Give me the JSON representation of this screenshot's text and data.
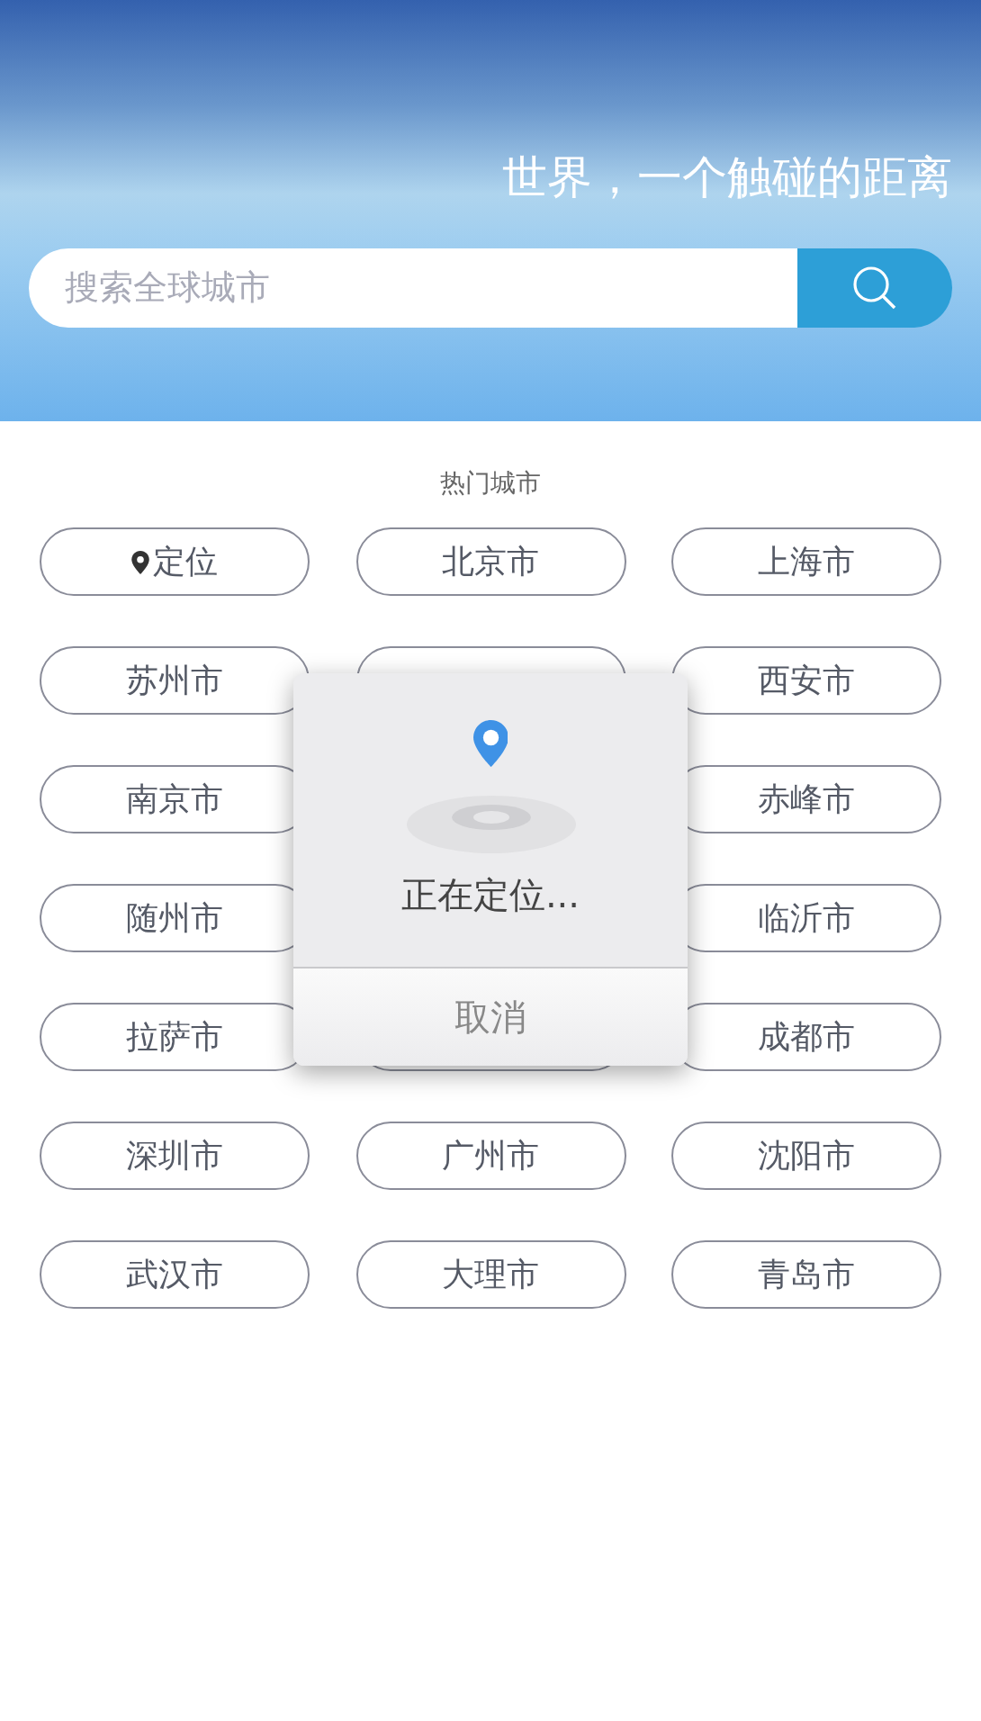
{
  "header": {
    "slogan": "世界，一个触碰的距离"
  },
  "search": {
    "placeholder": "搜索全球城市"
  },
  "hot_cities": {
    "title": "热门城市",
    "rows": [
      [
        {
          "kind": "locate",
          "label": "定位"
        },
        {
          "kind": "city",
          "label": "北京市"
        },
        {
          "kind": "city",
          "label": "上海市"
        }
      ],
      [
        {
          "kind": "city",
          "label": "苏州市"
        },
        {
          "kind": "covered"
        },
        {
          "kind": "city",
          "label": "西安市"
        }
      ],
      [
        {
          "kind": "city",
          "label": "南京市"
        },
        {
          "kind": "city",
          "label": "赤峰市"
        }
      ],
      [
        {
          "kind": "city",
          "label": "随州市"
        },
        {
          "kind": "city",
          "label": "临沂市"
        }
      ],
      [
        {
          "kind": "city",
          "label": "拉萨市"
        },
        {
          "kind": "covered"
        },
        {
          "kind": "city",
          "label": "成都市"
        }
      ],
      [
        {
          "kind": "city",
          "label": "深圳市"
        },
        {
          "kind": "city",
          "label": "广州市"
        },
        {
          "kind": "city",
          "label": "沈阳市"
        }
      ],
      [
        {
          "kind": "city",
          "label": "武汉市"
        },
        {
          "kind": "city",
          "label": "大理市"
        },
        {
          "kind": "city",
          "label": "青岛市"
        }
      ]
    ]
  },
  "dialog": {
    "message": "正在定位...",
    "cancel": "取消"
  }
}
